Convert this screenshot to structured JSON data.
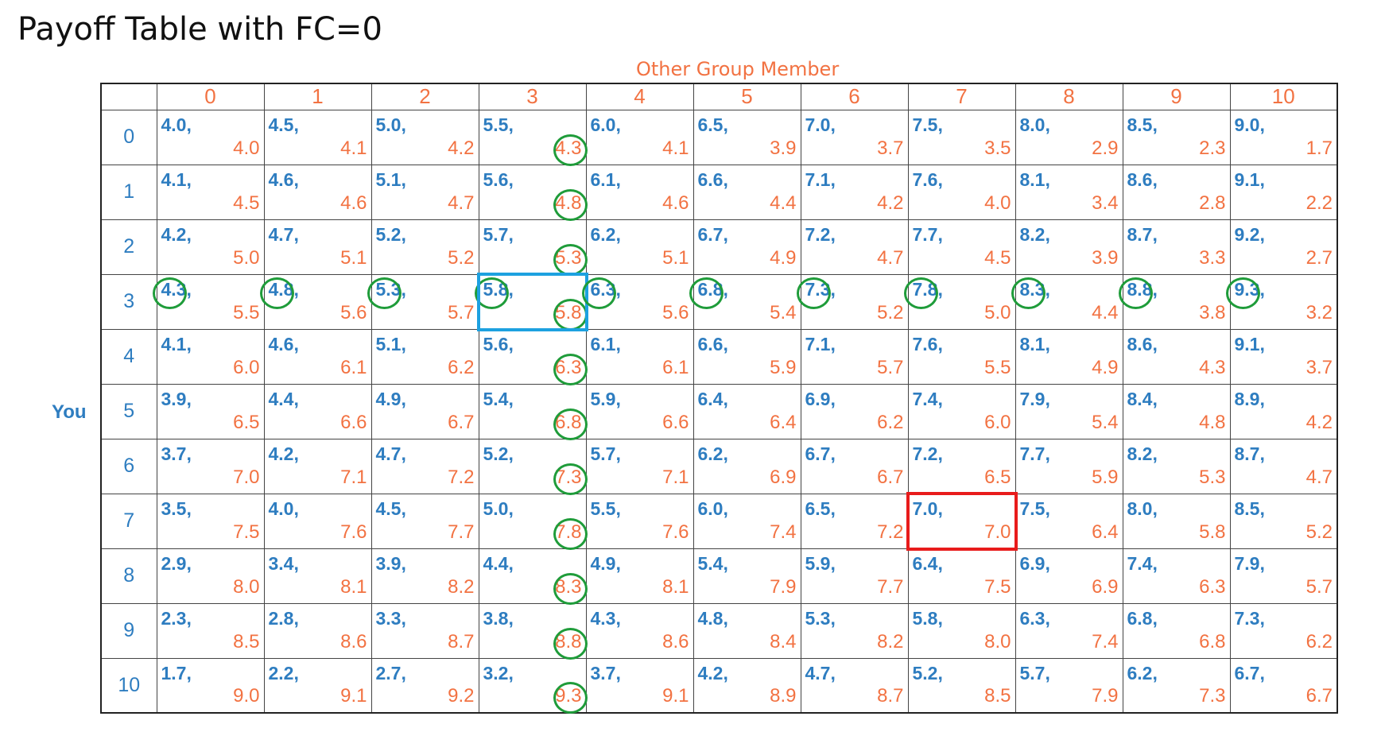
{
  "title": "Payoff Table with FC=0",
  "column_axis_label": "Other Group Member",
  "row_axis_label": "You",
  "colors": {
    "you_value": "#2e7dc0",
    "other_value": "#f27242",
    "best_response_circle": "#1f9c3a",
    "equilibrium_box": "#1da1e0",
    "highlight_box": "#e81b1b"
  },
  "columns": [
    "0",
    "1",
    "2",
    "3",
    "4",
    "5",
    "6",
    "7",
    "8",
    "9",
    "10"
  ],
  "rows": [
    {
      "label": "0",
      "cells": [
        [
          "4.0,",
          "4.0"
        ],
        [
          "4.5,",
          "4.1"
        ],
        [
          "5.0,",
          "4.2"
        ],
        [
          "5.5,",
          "4.3"
        ],
        [
          "6.0,",
          "4.1"
        ],
        [
          "6.5,",
          "3.9"
        ],
        [
          "7.0,",
          "3.7"
        ],
        [
          "7.5,",
          "3.5"
        ],
        [
          "8.0,",
          "2.9"
        ],
        [
          "8.5,",
          "2.3"
        ],
        [
          "9.0,",
          "1.7"
        ]
      ]
    },
    {
      "label": "1",
      "cells": [
        [
          "4.1,",
          "4.5"
        ],
        [
          "4.6,",
          "4.6"
        ],
        [
          "5.1,",
          "4.7"
        ],
        [
          "5.6,",
          "4.8"
        ],
        [
          "6.1,",
          "4.6"
        ],
        [
          "6.6,",
          "4.4"
        ],
        [
          "7.1,",
          "4.2"
        ],
        [
          "7.6,",
          "4.0"
        ],
        [
          "8.1,",
          "3.4"
        ],
        [
          "8.6,",
          "2.8"
        ],
        [
          "9.1,",
          "2.2"
        ]
      ]
    },
    {
      "label": "2",
      "cells": [
        [
          "4.2,",
          "5.0"
        ],
        [
          "4.7,",
          "5.1"
        ],
        [
          "5.2,",
          "5.2"
        ],
        [
          "5.7,",
          "5.3"
        ],
        [
          "6.2,",
          "5.1"
        ],
        [
          "6.7,",
          "4.9"
        ],
        [
          "7.2,",
          "4.7"
        ],
        [
          "7.7,",
          "4.5"
        ],
        [
          "8.2,",
          "3.9"
        ],
        [
          "8.7,",
          "3.3"
        ],
        [
          "9.2,",
          "2.7"
        ]
      ]
    },
    {
      "label": "3",
      "cells": [
        [
          "4.3,",
          "5.5"
        ],
        [
          "4.8,",
          "5.6"
        ],
        [
          "5.3,",
          "5.7"
        ],
        [
          "5.8,",
          "5.8"
        ],
        [
          "6.3,",
          "5.6"
        ],
        [
          "6.8,",
          "5.4"
        ],
        [
          "7.3,",
          "5.2"
        ],
        [
          "7.8,",
          "5.0"
        ],
        [
          "8.3,",
          "4.4"
        ],
        [
          "8.8,",
          "3.8"
        ],
        [
          "9.3,",
          "3.2"
        ]
      ]
    },
    {
      "label": "4",
      "cells": [
        [
          "4.1,",
          "6.0"
        ],
        [
          "4.6,",
          "6.1"
        ],
        [
          "5.1,",
          "6.2"
        ],
        [
          "5.6,",
          "6.3"
        ],
        [
          "6.1,",
          "6.1"
        ],
        [
          "6.6,",
          "5.9"
        ],
        [
          "7.1,",
          "5.7"
        ],
        [
          "7.6,",
          "5.5"
        ],
        [
          "8.1,",
          "4.9"
        ],
        [
          "8.6,",
          "4.3"
        ],
        [
          "9.1,",
          "3.7"
        ]
      ]
    },
    {
      "label": "5",
      "cells": [
        [
          "3.9,",
          "6.5"
        ],
        [
          "4.4,",
          "6.6"
        ],
        [
          "4.9,",
          "6.7"
        ],
        [
          "5.4,",
          "6.8"
        ],
        [
          "5.9,",
          "6.6"
        ],
        [
          "6.4,",
          "6.4"
        ],
        [
          "6.9,",
          "6.2"
        ],
        [
          "7.4,",
          "6.0"
        ],
        [
          "7.9,",
          "5.4"
        ],
        [
          "8.4,",
          "4.8"
        ],
        [
          "8.9,",
          "4.2"
        ]
      ]
    },
    {
      "label": "6",
      "cells": [
        [
          "3.7,",
          "7.0"
        ],
        [
          "4.2,",
          "7.1"
        ],
        [
          "4.7,",
          "7.2"
        ],
        [
          "5.2,",
          "7.3"
        ],
        [
          "5.7,",
          "7.1"
        ],
        [
          "6.2,",
          "6.9"
        ],
        [
          "6.7,",
          "6.7"
        ],
        [
          "7.2,",
          "6.5"
        ],
        [
          "7.7,",
          "5.9"
        ],
        [
          "8.2,",
          "5.3"
        ],
        [
          "8.7,",
          "4.7"
        ]
      ]
    },
    {
      "label": "7",
      "cells": [
        [
          "3.5,",
          "7.5"
        ],
        [
          "4.0,",
          "7.6"
        ],
        [
          "4.5,",
          "7.7"
        ],
        [
          "5.0,",
          "7.8"
        ],
        [
          "5.5,",
          "7.6"
        ],
        [
          "6.0,",
          "7.4"
        ],
        [
          "6.5,",
          "7.2"
        ],
        [
          "7.0,",
          "7.0"
        ],
        [
          "7.5,",
          "6.4"
        ],
        [
          "8.0,",
          "5.8"
        ],
        [
          "8.5,",
          "5.2"
        ]
      ]
    },
    {
      "label": "8",
      "cells": [
        [
          "2.9,",
          "8.0"
        ],
        [
          "3.4,",
          "8.1"
        ],
        [
          "3.9,",
          "8.2"
        ],
        [
          "4.4,",
          "8.3"
        ],
        [
          "4.9,",
          "8.1"
        ],
        [
          "5.4,",
          "7.9"
        ],
        [
          "5.9,",
          "7.7"
        ],
        [
          "6.4,",
          "7.5"
        ],
        [
          "6.9,",
          "6.9"
        ],
        [
          "7.4,",
          "6.3"
        ],
        [
          "7.9,",
          "5.7"
        ]
      ]
    },
    {
      "label": "9",
      "cells": [
        [
          "2.3,",
          "8.5"
        ],
        [
          "2.8,",
          "8.6"
        ],
        [
          "3.3,",
          "8.7"
        ],
        [
          "3.8,",
          "8.8"
        ],
        [
          "4.3,",
          "8.6"
        ],
        [
          "4.8,",
          "8.4"
        ],
        [
          "5.3,",
          "8.2"
        ],
        [
          "5.8,",
          "8.0"
        ],
        [
          "6.3,",
          "7.4"
        ],
        [
          "6.8,",
          "6.8"
        ],
        [
          "7.3,",
          "6.2"
        ]
      ]
    },
    {
      "label": "10",
      "cells": [
        [
          "1.7,",
          "9.0"
        ],
        [
          "2.2,",
          "9.1"
        ],
        [
          "2.7,",
          "9.2"
        ],
        [
          "3.2,",
          "9.3"
        ],
        [
          "3.7,",
          "9.1"
        ],
        [
          "4.2,",
          "8.9"
        ],
        [
          "4.7,",
          "8.7"
        ],
        [
          "5.2,",
          "8.5"
        ],
        [
          "5.7,",
          "7.9"
        ],
        [
          "6.2,",
          "7.3"
        ],
        [
          "6.7,",
          "6.7"
        ]
      ]
    }
  ],
  "highlights": {
    "you_best_response_circled_row": "3",
    "other_best_response_circled_column": "3",
    "equilibrium_cell": {
      "row": "3",
      "column": "3"
    },
    "red_box_cell": {
      "row": "7",
      "column": "7"
    }
  }
}
